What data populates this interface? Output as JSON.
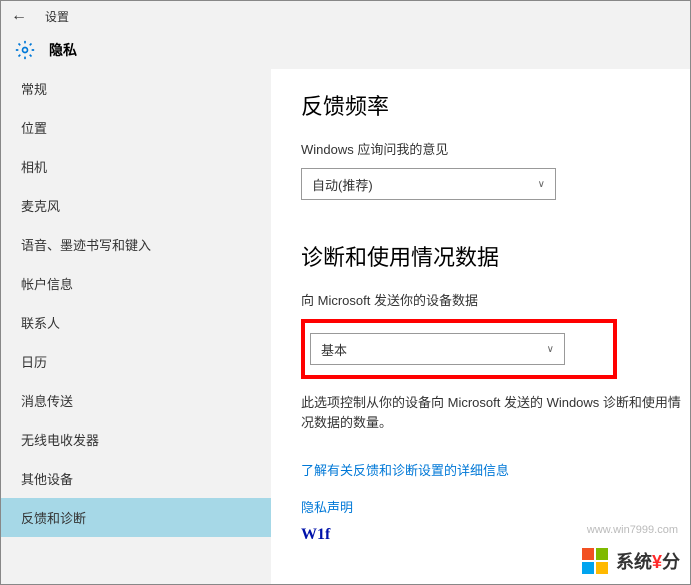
{
  "titlebar": {
    "back_icon": "←",
    "title": "设置"
  },
  "header": {
    "title": "隐私"
  },
  "sidebar": {
    "items": [
      {
        "label": "常规",
        "active": false
      },
      {
        "label": "位置",
        "active": false
      },
      {
        "label": "相机",
        "active": false
      },
      {
        "label": "麦克风",
        "active": false
      },
      {
        "label": "语音、墨迹书写和键入",
        "active": false
      },
      {
        "label": "帐户信息",
        "active": false
      },
      {
        "label": "联系人",
        "active": false
      },
      {
        "label": "日历",
        "active": false
      },
      {
        "label": "消息传送",
        "active": false
      },
      {
        "label": "无线电收发器",
        "active": false
      },
      {
        "label": "其他设备",
        "active": false
      },
      {
        "label": "反馈和诊断",
        "active": true
      }
    ]
  },
  "main": {
    "section1": {
      "title": "反馈频率",
      "label": "Windows 应询问我的意见",
      "dropdown_value": "自动(推荐)"
    },
    "section2": {
      "title": "诊断和使用情况数据",
      "label": "向 Microsoft 发送你的设备数据",
      "dropdown_value": "基本",
      "description": "此选项控制从你的设备向 Microsoft 发送的 Windows 诊断和使用情况数据的数量。",
      "link1": "了解有关反馈和诊断设置的详细信息",
      "link2": "隐私声明"
    }
  },
  "watermark": {
    "text_prefix": "系统",
    "text_accent": "¥",
    "text_suffix": "分",
    "url": "www.win7999.com",
    "partial": "W1f"
  }
}
